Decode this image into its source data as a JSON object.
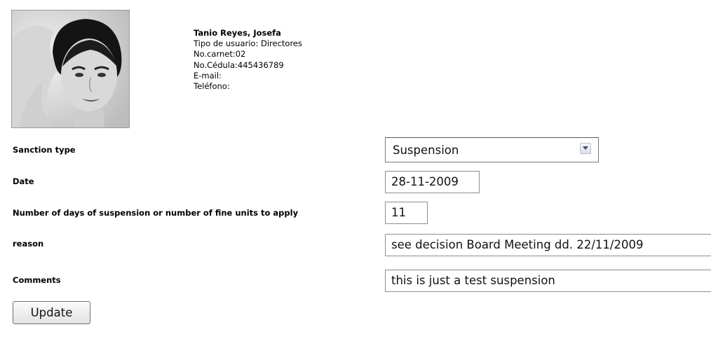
{
  "user": {
    "name": "Tanio Reyes, Josefa",
    "user_type": "Tipo de usuario: Directores",
    "carnet": "No.carnet:02",
    "cedula": "No.Cédula:445436789",
    "email": "E-mail:",
    "phone": "Teléfono:"
  },
  "form": {
    "sanction_type": {
      "label": "Sanction type",
      "selected": "Suspension"
    },
    "date": {
      "label": "Date",
      "value": "28-11-2009"
    },
    "days": {
      "label": "Number of days of suspension or number of fine units to apply",
      "value": "11"
    },
    "reason": {
      "label": "reason",
      "value": "see decision Board Meeting dd. 22/11/2009"
    },
    "comments": {
      "label": "Comments",
      "value": "this is just a test suspension"
    },
    "update_label": "Update"
  },
  "icons": {
    "photo": "user-photo",
    "dropdown": "chevron-down-icon"
  }
}
